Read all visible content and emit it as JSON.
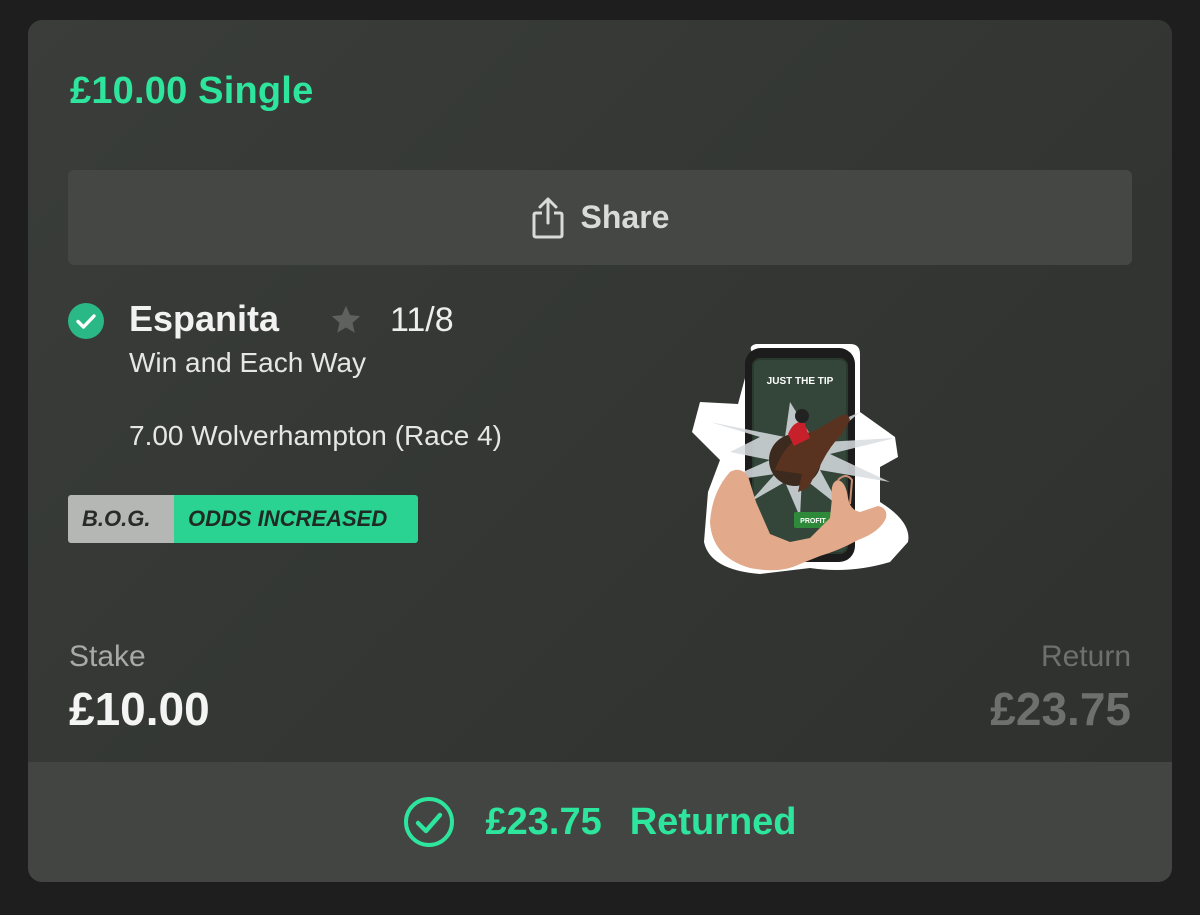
{
  "bet": {
    "title": "£10.00 Single",
    "share_label": "Share",
    "selection": {
      "name": "Espanita",
      "odds": "11/8",
      "market": "Win and Each Way",
      "event": "7.00 Wolverhampton (Race 4)"
    },
    "badges": {
      "bog": "B.O.G.",
      "odds_increased": "ODDS INCREASED"
    },
    "stake": {
      "label": "Stake",
      "value": "£10.00"
    },
    "return": {
      "label": "Return",
      "value": "£23.75"
    },
    "result": {
      "amount": "£23.75",
      "status": "Returned"
    }
  },
  "sticker": {
    "caption": "JUST THE TIP",
    "button": "PROFIT"
  },
  "colors": {
    "accent": "#2ee59d",
    "card": "#363936",
    "footer": "#434543",
    "muted": "#6d706d"
  },
  "icons": {
    "share": "share-icon",
    "check": "check-circle-icon",
    "star": "star-icon"
  }
}
